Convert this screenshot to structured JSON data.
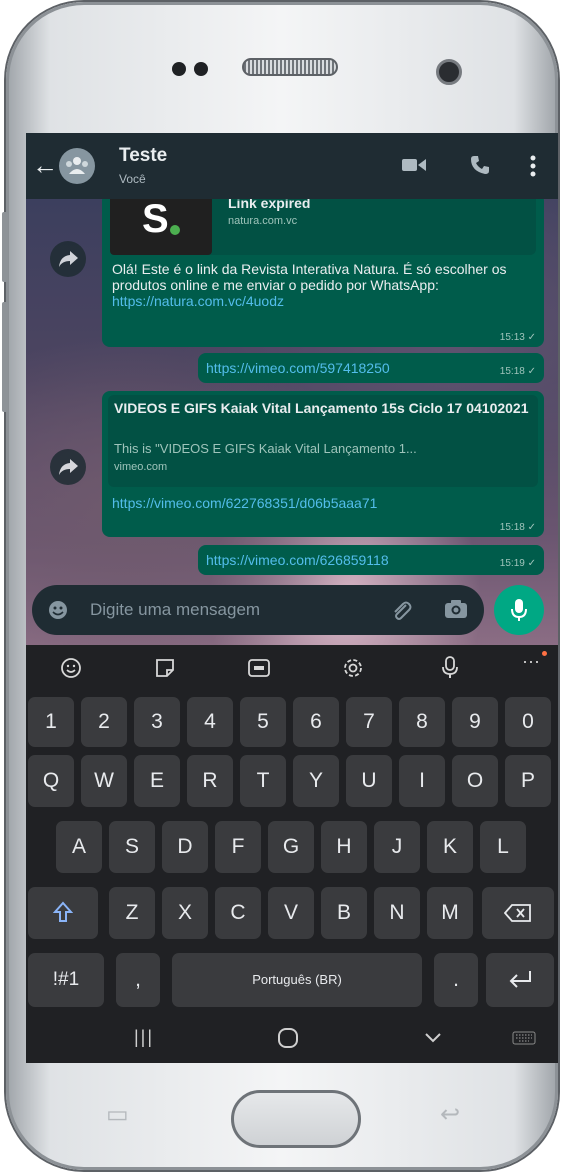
{
  "app_bar": {
    "title": "Teste",
    "subtitle": "Você"
  },
  "messages": {
    "m1": {
      "link_preview_title": "Link expired",
      "link_preview_domain": "natura.com.vc",
      "text": "Olá! Este é o link da Revista Interativa Natura. É só escolher os produtos online e me enviar o pedido por WhatsApp: ",
      "link": "https://natura.com.vc/4uodz",
      "time": "15:13"
    },
    "m2": {
      "link": "https://vimeo.com/597418250",
      "time": "15:18"
    },
    "m3": {
      "preview_title": "VIDEOS E GIFS Kaiak Vital Lançamento 15s Ciclo 17 04102021",
      "preview_desc": "This is \"VIDEOS E GIFS Kaiak Vital Lançamento 1...",
      "preview_domain": "vimeo.com",
      "link": "https://vimeo.com/622768351/d06b5aaa71",
      "time": "15:18"
    },
    "m4": {
      "link": "https://vimeo.com/626859118",
      "time": "15:19"
    }
  },
  "input": {
    "placeholder": "Digite uma mensagem"
  },
  "keyboard": {
    "row_numbers": [
      "1",
      "2",
      "3",
      "4",
      "5",
      "6",
      "7",
      "8",
      "9",
      "0"
    ],
    "row_q": [
      "Q",
      "W",
      "E",
      "R",
      "T",
      "Y",
      "U",
      "I",
      "O",
      "P"
    ],
    "row_a": [
      "A",
      "S",
      "D",
      "F",
      "G",
      "H",
      "J",
      "K",
      "L"
    ],
    "row_z": [
      "Z",
      "X",
      "C",
      "V",
      "B",
      "N",
      "M"
    ],
    "symbols": "!#1",
    "comma": ",",
    "space": "Português (BR)",
    "period": "."
  },
  "icons": {
    "tool_icons": [
      "emoji-icon",
      "sticker-icon",
      "gif-icon",
      "settings-icon",
      "mic-icon",
      "more-icon"
    ]
  },
  "colors": {
    "app_bar": "#1f2c33",
    "bubble_out": "#005c4b",
    "accent": "#00a884",
    "link": "#53bdeb"
  }
}
